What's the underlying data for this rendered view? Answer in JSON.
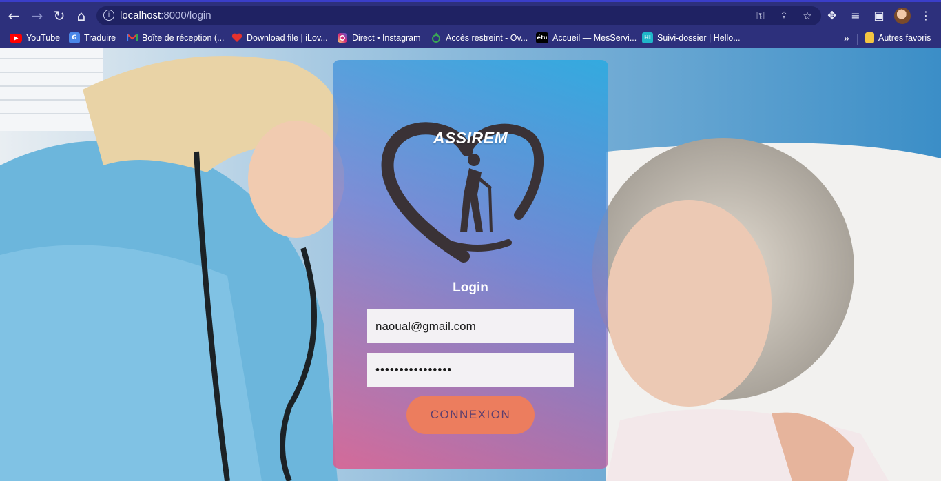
{
  "browser": {
    "url_host": "localhost",
    "url_path": ":8000/login",
    "bookmarks": [
      {
        "label": "YouTube",
        "icon": "youtube-icon",
        "color": "#ff0000"
      },
      {
        "label": "Traduire",
        "icon": "google-translate-icon",
        "color": "#4a86e8"
      },
      {
        "label": "Boîte de réception (...",
        "icon": "gmail-icon",
        "color": "#ea4335"
      },
      {
        "label": "Download file | iLov...",
        "icon": "ilovepdf-heart-icon",
        "color": "#e5322d"
      },
      {
        "label": "Direct • Instagram",
        "icon": "instagram-icon",
        "color": "#d6249f"
      },
      {
        "label": "Accès restreint - Ov...",
        "icon": "leaf-icon",
        "color": "#3aa655"
      },
      {
        "label": "Accueil — MesServi...",
        "icon": "etu-icon",
        "color": "#000000"
      },
      {
        "label": "Suivi-dossier | Hello...",
        "icon": "hi-icon",
        "color": "#1fb6c9"
      }
    ],
    "other_bookmarks": "Autres favoris",
    "overflow": "»",
    "etu_glyph": "étu",
    "hi_glyph": "HI"
  },
  "login": {
    "brand": "ASSIREM",
    "title": "Login",
    "email_value": "naoual@gmail.com",
    "password_value": "••••••••••••••••",
    "button_label": "CONNEXION"
  },
  "colors": {
    "chrome": "#2d307c",
    "card_top": "#28aae1",
    "card_bottom": "#dc5a8c",
    "button": "#ec7d5e"
  }
}
